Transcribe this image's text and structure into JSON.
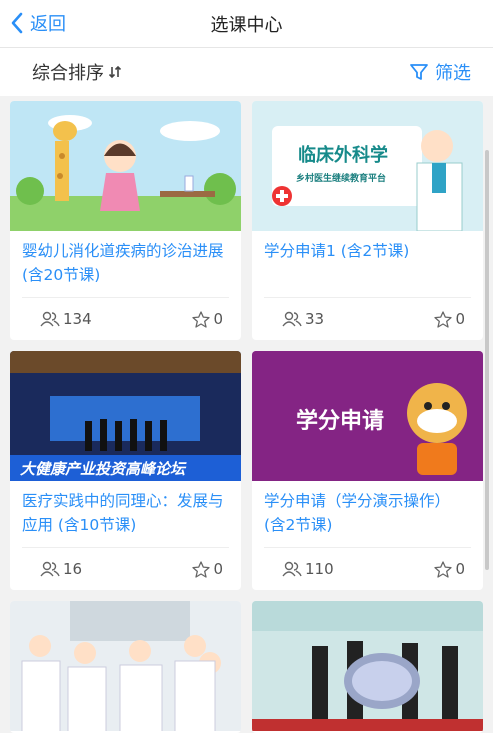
{
  "nav": {
    "back_label": "返回",
    "title": "选课中心"
  },
  "filter_bar": {
    "sort_label": "综合排序",
    "filter_label": "筛选"
  },
  "courses": [
    {
      "title": "婴幼儿消化道疾病的诊治进展 (含20节课)",
      "learners": "134",
      "favorites": "0"
    },
    {
      "title": "学分申请1 (含2节课)",
      "learners": "33",
      "favorites": "0",
      "thumb_heading": "临床外科学",
      "thumb_sub": "乡村医生继续教育平台"
    },
    {
      "title": "医疗实践中的同理心：发展与应用 (含10节课)",
      "learners": "16",
      "favorites": "0",
      "thumb_text": "大健康产业投资高峰论坛"
    },
    {
      "title": "学分申请（学分演示操作）(含2节课)",
      "learners": "110",
      "favorites": "0",
      "thumb_heading": "学分申请"
    },
    {
      "title": "",
      "learners": "",
      "favorites": ""
    },
    {
      "title": "",
      "learners": "",
      "favorites": ""
    }
  ],
  "colors": {
    "accent": "#2a8ff7",
    "background": "#f2f2f2"
  }
}
